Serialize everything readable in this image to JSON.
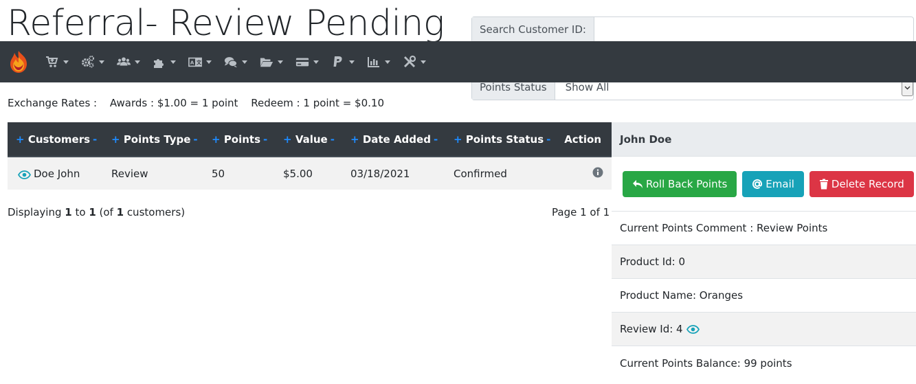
{
  "page": {
    "title": "Referral- Review Pending"
  },
  "search": {
    "label": "Search Customer ID:",
    "value": "",
    "placeholder": ""
  },
  "navbar": {
    "items": [
      {
        "icon": "shopping-cart-icon"
      },
      {
        "icon": "cogs-icon"
      },
      {
        "icon": "users-icon"
      },
      {
        "icon": "puzzle-piece-icon"
      },
      {
        "icon": "language-icon"
      },
      {
        "icon": "comments-icon"
      },
      {
        "icon": "folder-open-icon"
      },
      {
        "icon": "credit-card-icon"
      },
      {
        "icon": "paypal-icon"
      },
      {
        "icon": "chart-bar-icon"
      },
      {
        "icon": "tools-icon"
      }
    ]
  },
  "status_filter": {
    "label": "Points Status",
    "selected": "Show All"
  },
  "exchange": {
    "label": "Exchange Rates :",
    "awards": "Awards : $1.00 = 1 point",
    "redeem": "Redeem : 1 point = $0.10"
  },
  "table": {
    "sort_plus": "+",
    "sort_minus": "-",
    "columns": [
      "Customers",
      "Points Type",
      "Points",
      "Value",
      "Date Added",
      "Points Status",
      "Action"
    ],
    "rows": [
      {
        "customer": "Doe John",
        "points_type": "Review",
        "points": "50",
        "value": "$5.00",
        "date_added": "03/18/2021",
        "points_status": "Confirmed"
      }
    ]
  },
  "footer": {
    "displaying_prefix": "Displaying ",
    "from": "1",
    "to_word": " to ",
    "to": "1",
    "of_prefix": " (of ",
    "total": "1",
    "of_suffix": " customers)",
    "page_text": "Page 1 of 1"
  },
  "detail": {
    "name": "John Doe",
    "rollback_label": "Roll Back Points",
    "email_label": "Email",
    "delete_label": "Delete Record",
    "comment": "Current Points Comment : Review Points",
    "product_id": "Product Id: 0",
    "product_name": "Product Name: Oranges",
    "review_id": "Review Id: 4",
    "balance": "Current Points Balance: 99 points"
  },
  "colors": {
    "navbar": "#343a40",
    "success": "#28a745",
    "info": "#17a2b8",
    "danger": "#dc3545",
    "sort": "#1e8bff"
  }
}
